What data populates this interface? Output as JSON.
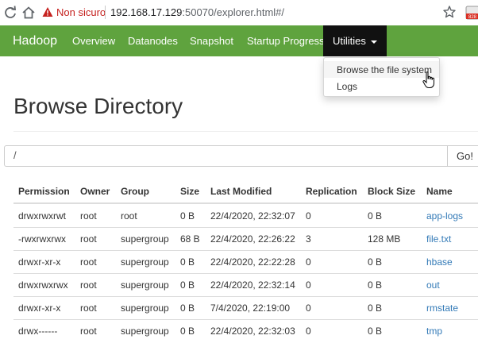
{
  "browser": {
    "security_label": "Non sicuro",
    "url_host": "192.168.17.129",
    "url_rest": ":50070/explorer.html#/",
    "extension_badge": "828"
  },
  "navbar": {
    "brand": "Hadoop",
    "links": [
      "Overview",
      "Datanodes",
      "Snapshot",
      "Startup Progress"
    ],
    "active": "Utilities"
  },
  "dropdown": {
    "items": [
      "Browse the file system",
      "Logs"
    ]
  },
  "page": {
    "title": "Browse Directory",
    "path_value": "/",
    "go_label": "Go!"
  },
  "table": {
    "headers": [
      "Permission",
      "Owner",
      "Group",
      "Size",
      "Last Modified",
      "Replication",
      "Block Size",
      "Name"
    ],
    "rows": [
      [
        "drwxrwxrwt",
        "root",
        "root",
        "0 B",
        "22/4/2020, 22:32:07",
        "0",
        "0 B",
        "app-logs"
      ],
      [
        "-rwxrwxrwx",
        "root",
        "supergroup",
        "68 B",
        "22/4/2020, 22:26:22",
        "3",
        "128 MB",
        "file.txt"
      ],
      [
        "drwxr-xr-x",
        "root",
        "supergroup",
        "0 B",
        "22/4/2020, 22:22:28",
        "0",
        "0 B",
        "hbase"
      ],
      [
        "drwxrwxrwx",
        "root",
        "supergroup",
        "0 B",
        "22/4/2020, 22:32:14",
        "0",
        "0 B",
        "out"
      ],
      [
        "drwxr-xr-x",
        "root",
        "supergroup",
        "0 B",
        "7/4/2020, 22:19:00",
        "0",
        "0 B",
        "rmstate"
      ],
      [
        "drwx------",
        "root",
        "supergroup",
        "0 B",
        "22/4/2020, 22:32:03",
        "0",
        "0 B",
        "tmp"
      ]
    ]
  },
  "colors": {
    "navbar": "#5fa33e",
    "active_tab": "#111111",
    "link": "#337ab7",
    "warning": "#c5221f"
  }
}
